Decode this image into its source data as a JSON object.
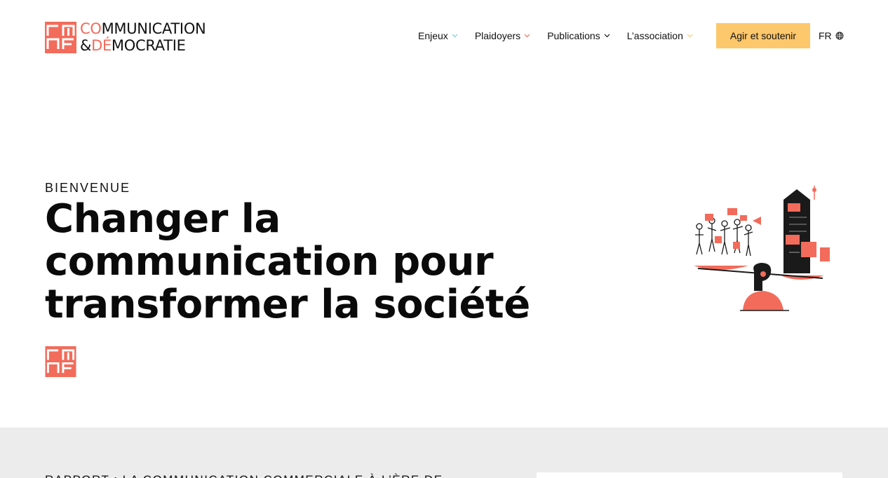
{
  "brand": {
    "line1_accent": "CO",
    "line1_rest": "MMUNICATION",
    "line2_prefix": "&",
    "line2_accent": "DÉ",
    "line2_rest": "MOCRATIE",
    "accent_color": "#f26b5b"
  },
  "nav": {
    "items": [
      {
        "label": "Enjeux",
        "chevron": "chevron-down-icon"
      },
      {
        "label": "Plaidoyers",
        "chevron": "chevron-down-icon"
      },
      {
        "label": "Publications",
        "chevron": "chevron-down-icon"
      },
      {
        "label": "L’association",
        "chevron": "chevron-down-icon"
      }
    ],
    "cta_label": "Agir et soutenir",
    "cta_color": "#fdc76b",
    "lang_label": "FR",
    "lang_icon": "globe-icon"
  },
  "hero": {
    "eyebrow": "BIENVENUE",
    "title": "Changer la communication pour transformer la société",
    "illustration_icon": "scale-illustration-icon"
  },
  "section": {
    "title": "RAPPORT : LA COMMUNICATION COMMERCIALE À L’ÈRE DE"
  }
}
